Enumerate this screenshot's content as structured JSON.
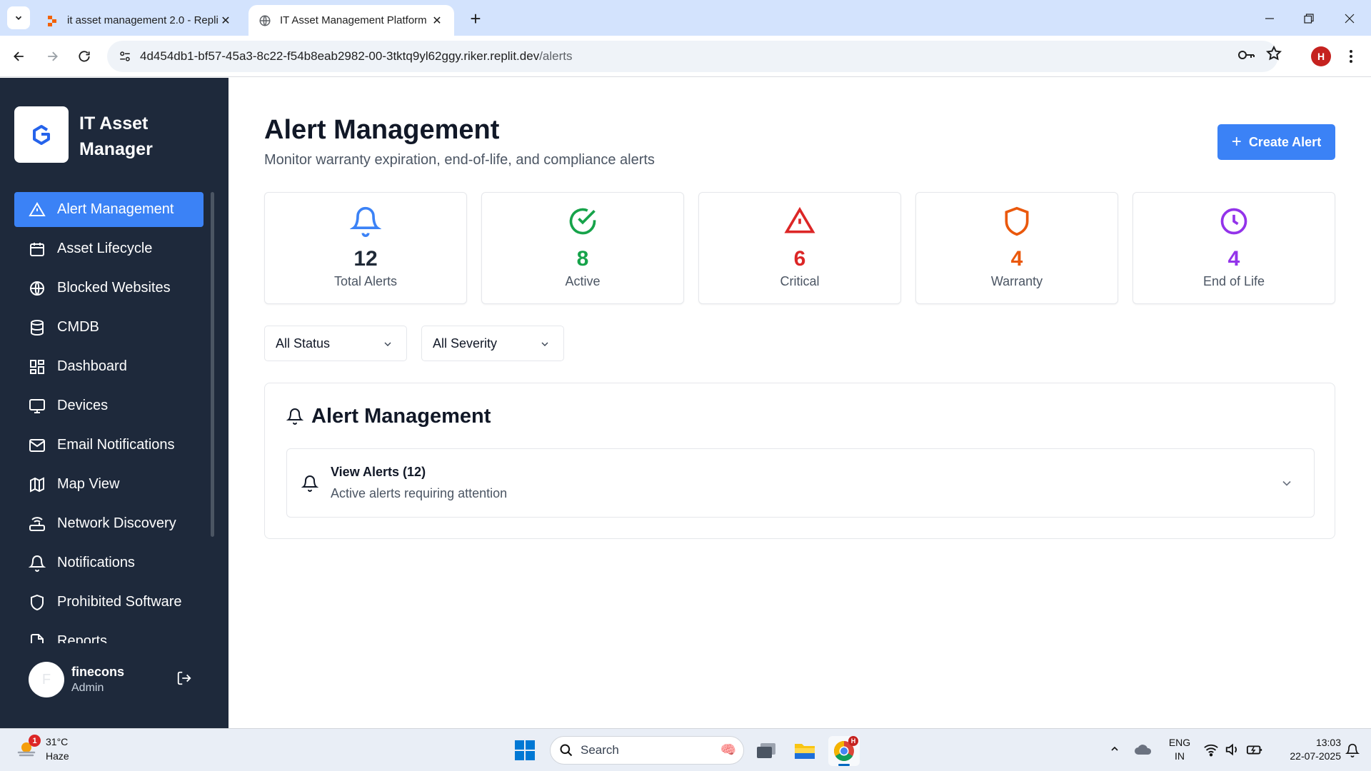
{
  "browser": {
    "tabs": [
      {
        "title": "it asset management 2.0 - Replit",
        "active": false
      },
      {
        "title": "IT Asset Management Platform",
        "active": true
      }
    ],
    "url_host": "4d454db1-bf57-45a3-8c22-f54b8eab2982-00-3tktq9yl62ggy.riker.replit.dev",
    "url_path": "/alerts",
    "profile_initial": "H"
  },
  "sidebar": {
    "brand_title": "IT Asset Manager",
    "items": [
      {
        "label": "Alert Management",
        "icon": "alert-triangle-icon",
        "active": true
      },
      {
        "label": "Asset Lifecycle",
        "icon": "calendar-icon",
        "active": false
      },
      {
        "label": "Blocked Websites",
        "icon": "globe-icon",
        "active": false
      },
      {
        "label": "CMDB",
        "icon": "database-icon",
        "active": false
      },
      {
        "label": "Dashboard",
        "icon": "dashboard-icon",
        "active": false
      },
      {
        "label": "Devices",
        "icon": "monitor-icon",
        "active": false
      },
      {
        "label": "Email Notifications",
        "icon": "mail-icon",
        "active": false
      },
      {
        "label": "Map View",
        "icon": "map-icon",
        "active": false
      },
      {
        "label": "Network Discovery",
        "icon": "router-icon",
        "active": false
      },
      {
        "label": "Notifications",
        "icon": "bell-icon",
        "active": false
      },
      {
        "label": "Prohibited Software",
        "icon": "shield-icon",
        "active": false
      },
      {
        "label": "Reports",
        "icon": "file-icon",
        "active": false
      }
    ],
    "user": {
      "initial": "F",
      "name": "finecons",
      "role": "Admin"
    }
  },
  "main": {
    "title": "Alert Management",
    "subtitle": "Monitor warranty expiration, end-of-life, and compliance alerts",
    "create_button": "Create Alert",
    "stats": [
      {
        "value": "12",
        "label": "Total Alerts",
        "color": "#1f2937",
        "icon": "bell-icon",
        "icon_color": "#3b82f6"
      },
      {
        "value": "8",
        "label": "Active",
        "color": "#16a34a",
        "icon": "check-circle-icon",
        "icon_color": "#16a34a"
      },
      {
        "value": "6",
        "label": "Critical",
        "color": "#dc2626",
        "icon": "alert-triangle-icon",
        "icon_color": "#dc2626"
      },
      {
        "value": "4",
        "label": "Warranty",
        "color": "#ea580c",
        "icon": "shield-icon",
        "icon_color": "#ea580c"
      },
      {
        "value": "4",
        "label": "End of Life",
        "color": "#9333ea",
        "icon": "clock-icon",
        "icon_color": "#9333ea"
      }
    ],
    "filters": {
      "status": "All Status",
      "severity": "All Severity"
    },
    "panel": {
      "title": "Alert Management",
      "accordion_title": "View Alerts (12)",
      "accordion_subtitle": "Active alerts requiring attention"
    }
  },
  "taskbar": {
    "weather_badge": "1",
    "temperature": "31°C",
    "condition": "Haze",
    "search_label": "Search",
    "lang_line1": "ENG",
    "lang_line2": "IN",
    "time": "13:03",
    "date": "22-07-2025",
    "chrome_badge": "H"
  },
  "colors": {
    "sidebar_bg": "#1e293b",
    "accent": "#3b82f6"
  }
}
